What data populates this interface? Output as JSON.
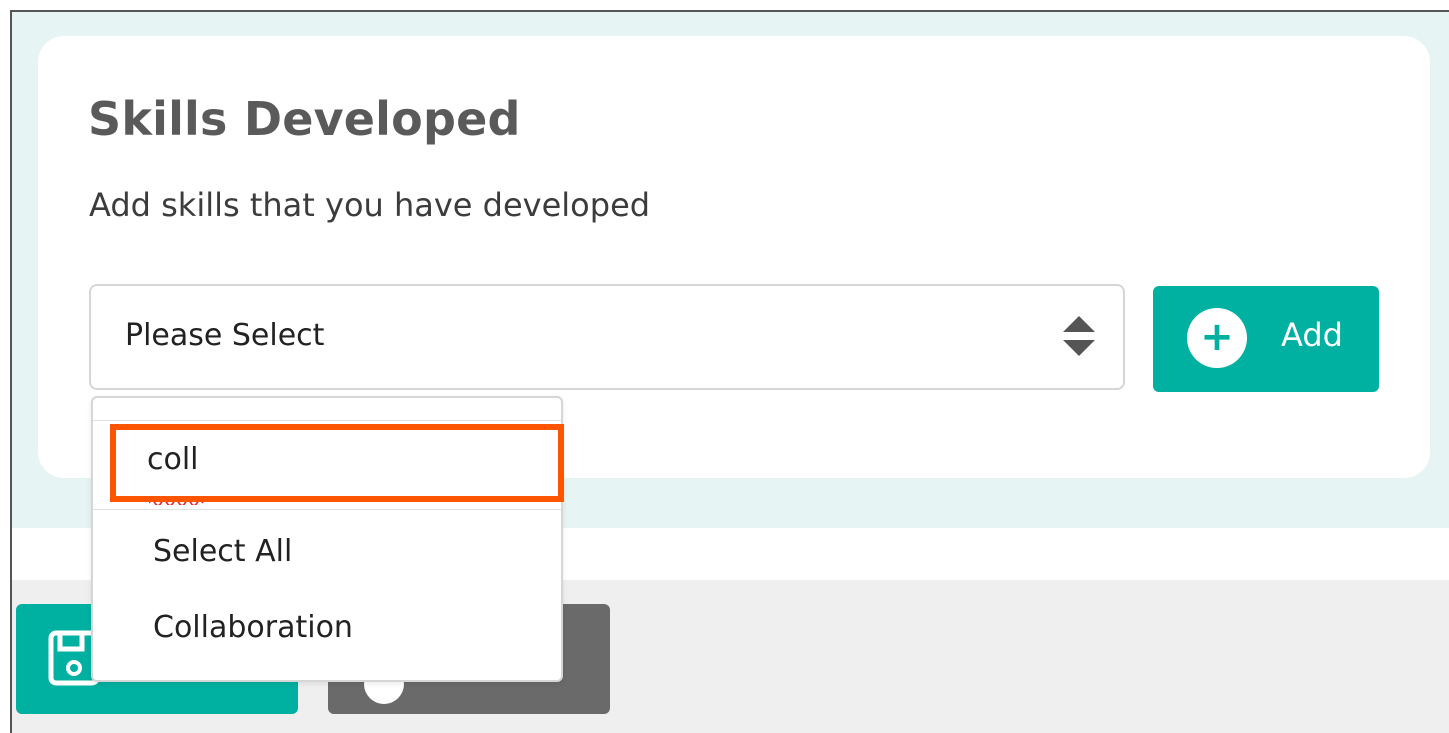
{
  "card": {
    "title": "Skills Developed",
    "subtitle": "Add skills that you have developed"
  },
  "select": {
    "value": "Please Select",
    "icon": "sort-icon"
  },
  "add_button": {
    "label": "Add",
    "icon": "plus-circle-icon"
  },
  "dropdown": {
    "search_value": "coll",
    "options": [
      {
        "label": "Select All"
      },
      {
        "label": "Collaboration"
      }
    ]
  },
  "footer": {
    "save_icon": "save-icon",
    "cancel_icon": "cancel-icon"
  },
  "colors": {
    "accent": "#00b0a0",
    "highlight": "#ff5500",
    "panel_bg": "#e6f4f4",
    "footer_bg": "#efefef",
    "cancel_bg": "#6a6a6a"
  }
}
